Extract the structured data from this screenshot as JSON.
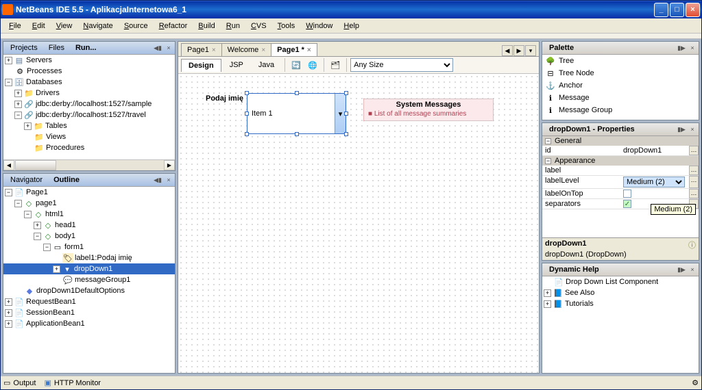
{
  "window": {
    "title": "NetBeans IDE 5.5 - AplikacjaInternetowa6_1"
  },
  "menu": {
    "file": "File",
    "edit": "Edit",
    "view": "View",
    "navigate": "Navigate",
    "source": "Source",
    "refactor": "Refactor",
    "build": "Build",
    "run": "Run",
    "cvs": "CVS",
    "tools": "Tools",
    "window": "Window",
    "help": "Help"
  },
  "projects": {
    "tabs": {
      "projects": "Projects",
      "files": "Files",
      "runtime": "Run..."
    },
    "nodes": {
      "servers": "Servers",
      "processes": "Processes",
      "databases": "Databases",
      "drivers": "Drivers",
      "conn1": "jdbc:derby://localhost:1527/sample",
      "conn2": "jdbc:derby://localhost:1527/travel",
      "tables": "Tables",
      "views": "Views",
      "procedures": "Procedures"
    }
  },
  "navigator": {
    "tabs": {
      "navigator": "Navigator",
      "outline": "Outline"
    },
    "nodes": {
      "page1": "Page1",
      "page1lc": "page1",
      "html1": "html1",
      "head1": "head1",
      "body1": "body1",
      "form1": "form1",
      "label1": "label1:Podaj imię",
      "dropdown1": "dropDown1",
      "msg1": "messageGroup1",
      "ddopts": "dropDown1DefaultOptions",
      "reqbean": "RequestBean1",
      "sessbean": "SessionBean1",
      "appbean": "ApplicationBean1"
    }
  },
  "editor": {
    "tabs": {
      "page1": "Page1",
      "welcome": "Welcome",
      "page1star": "Page1 *"
    },
    "subtabs": {
      "design": "Design",
      "jsp": "JSP",
      "java": "Java"
    },
    "sizecombo": "Any Size",
    "canvas": {
      "label": "Podaj imię",
      "dropdownText": "Item 1",
      "msgTitle": "System Messages",
      "msgRow": "List of all message summaries"
    }
  },
  "palette": {
    "title": "Palette",
    "items": {
      "tree": "Tree",
      "treenode": "Tree Node",
      "anchor": "Anchor",
      "message": "Message",
      "msggroup": "Message Group"
    }
  },
  "properties": {
    "title": "dropDown1 - Properties",
    "section1": "General",
    "id_k": "id",
    "id_v": "dropDown1",
    "section2": "Appearance",
    "label_k": "label",
    "labelLevel_k": "labelLevel",
    "labelLevel_v": "Medium (2)",
    "labelOnTop_k": "labelOnTop",
    "separators_k": "separators",
    "tooltip": "Medium (2)",
    "desc1": "dropDown1",
    "desc2": "dropDown1 (DropDown)"
  },
  "dynhelp": {
    "title": "Dynamic Help",
    "items": {
      "dd": "Drop Down List Component",
      "see": "See Also",
      "tut": "Tutorials"
    }
  },
  "status": {
    "output": "Output",
    "http": "HTTP Monitor"
  }
}
